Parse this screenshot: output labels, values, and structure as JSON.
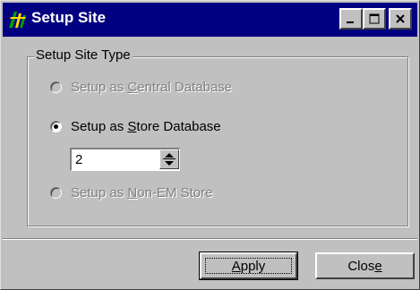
{
  "window": {
    "title": "Setup Site",
    "icon": "app-logo-icon",
    "controls": [
      "minimize-icon",
      "maximize-icon",
      "close-icon"
    ]
  },
  "group": {
    "label": "Setup Site Type"
  },
  "options": [
    {
      "pre": "Setup as ",
      "accel": "C",
      "post": "entral Database",
      "selected": false,
      "enabled": false
    },
    {
      "pre": "Setup as ",
      "accel": "S",
      "post": "tore Database",
      "selected": true,
      "enabled": true
    },
    {
      "pre": "Setup as ",
      "accel": "N",
      "post": "on-EM Store",
      "selected": false,
      "enabled": false
    }
  ],
  "store_number": {
    "value": "2"
  },
  "buttons": {
    "apply": {
      "accel": "A",
      "rest": "pply"
    },
    "close": {
      "pre": "Clos",
      "accel": "e"
    }
  },
  "colors": {
    "titlebar": "#000080",
    "face": "#c0c0c0",
    "disabled_text": "#808080"
  }
}
